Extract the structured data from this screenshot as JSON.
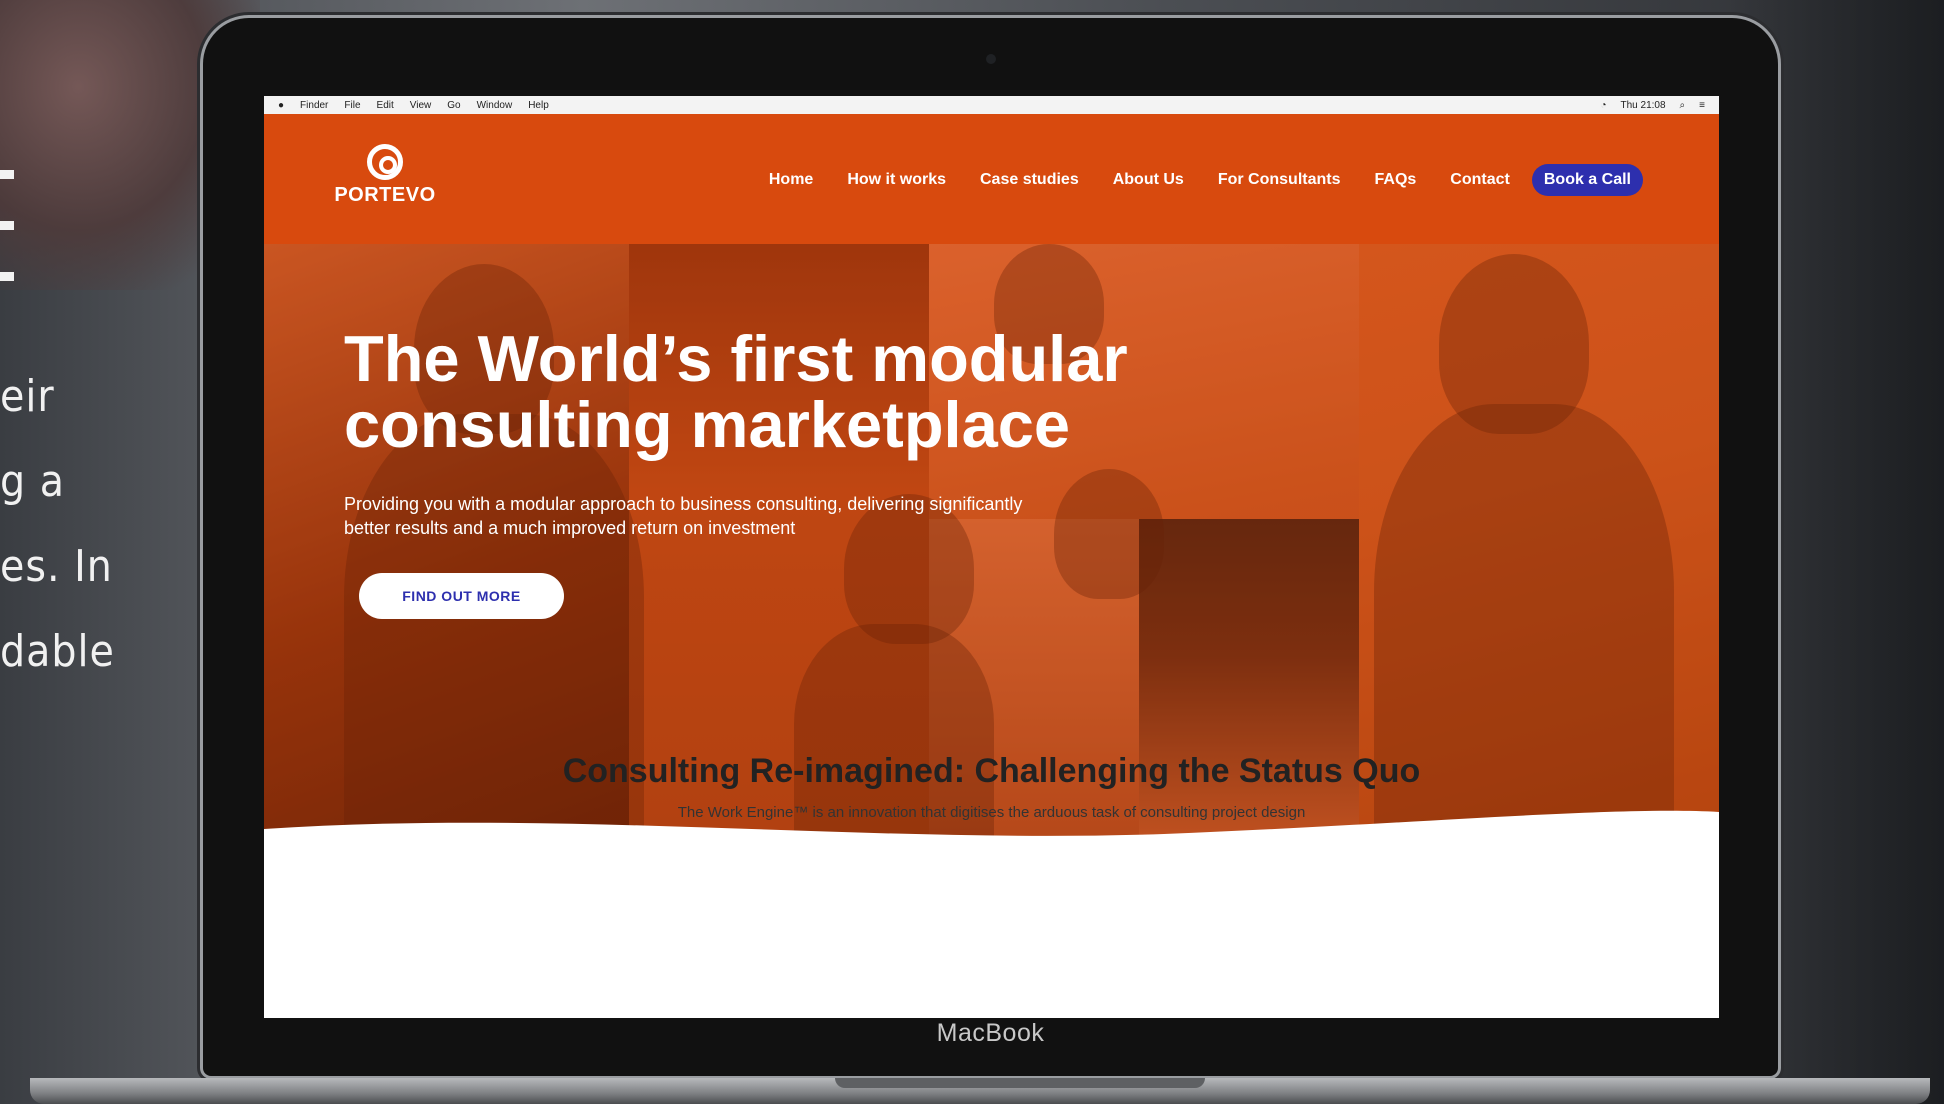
{
  "background": {
    "side_lines": [
      "eir",
      "g a",
      "es. In",
      "dable"
    ]
  },
  "device": {
    "brand": "MacBook"
  },
  "menubar": {
    "items": [
      "Finder",
      "File",
      "Edit",
      "View",
      "Go",
      "Window",
      "Help"
    ],
    "status": [
      "Thu 21:08"
    ]
  },
  "site": {
    "logo_text": "PORTEVO",
    "nav": [
      "Home",
      "How it works",
      "Case studies",
      "About Us",
      "For Consultants",
      "FAQs",
      "Contact"
    ],
    "cta_label": "Book a Call",
    "colors": {
      "brand_orange": "#d84a0e",
      "cta_blue": "#2d2fae"
    }
  },
  "hero": {
    "title_line1": "The World’s first modular",
    "title_line2": "consulting marketplace",
    "subtitle": "Providing you with a modular approach to business consulting, delivering significantly better results and a much improved return on investment",
    "button_label": "FIND OUT MORE"
  },
  "section": {
    "title": "Consulting Re-imagined: Challenging the Status Quo",
    "subtitle": "The Work Engine™ is an innovation that digitises the arduous task of consulting project design"
  }
}
